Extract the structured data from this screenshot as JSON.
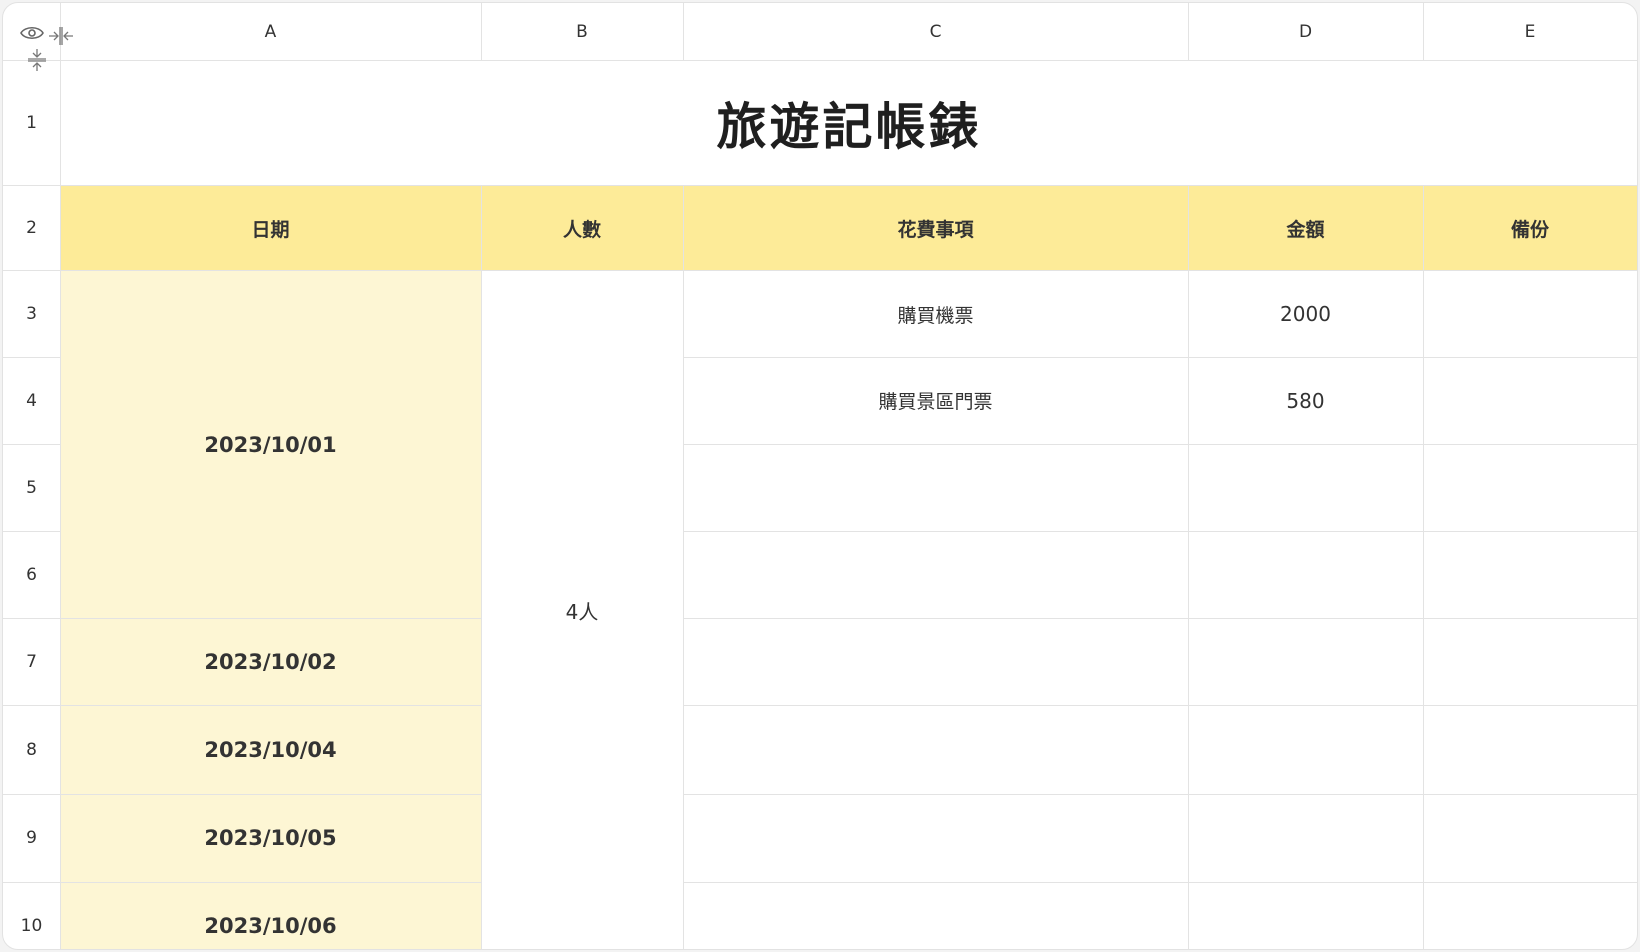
{
  "columns": [
    "A",
    "B",
    "C",
    "D",
    "E"
  ],
  "rows": [
    "1",
    "2",
    "3",
    "4",
    "5",
    "6",
    "7",
    "8",
    "9",
    "10"
  ],
  "title": "旅遊記帳錶",
  "headers": {
    "date": "日期",
    "people": "人數",
    "item": "花費事項",
    "amount": "金額",
    "note": "備份"
  },
  "dates": [
    "2023/10/01",
    "2023/10/02",
    "2023/10/04",
    "2023/10/05",
    "2023/10/06"
  ],
  "people_count": "4人",
  "entries": [
    {
      "item": "購買機票",
      "amount": "2000"
    },
    {
      "item": "購買景區門票",
      "amount": "580"
    }
  ],
  "colors": {
    "header_fill": "#fdeb98",
    "date_fill": "#fdf6d4",
    "grid": "#e3e3e3"
  },
  "icons": [
    "eye-icon",
    "column-collapse-icon",
    "row-collapse-icon"
  ]
}
